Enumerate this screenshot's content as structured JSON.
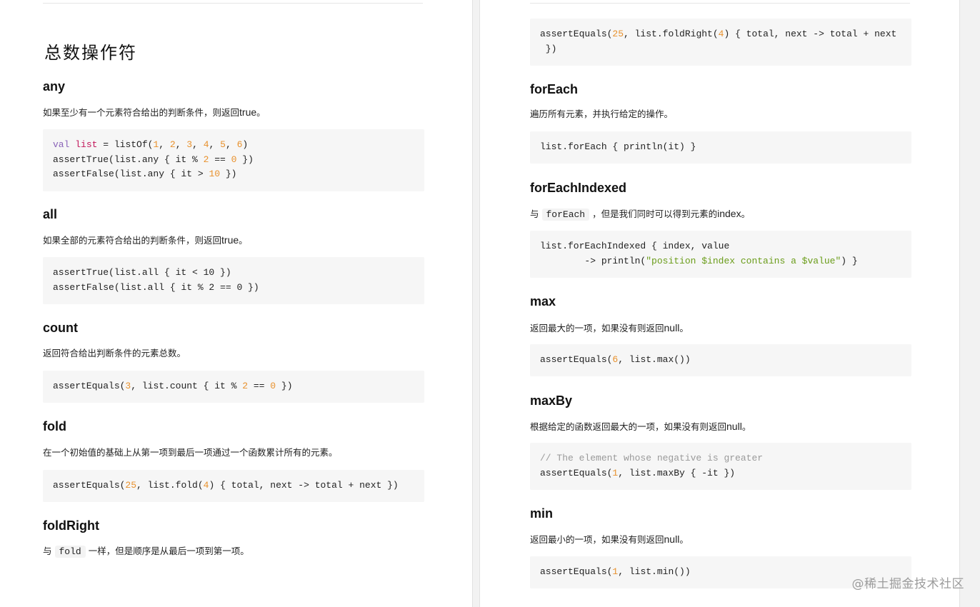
{
  "left": {
    "title": "总数操作符",
    "any": {
      "heading": "any",
      "desc_text": "如果至少有一个元素符合给出的判断条件，则返回",
      "desc_latin": "true",
      "desc_end": "。",
      "code": [
        [
          [
            "kw",
            "val"
          ],
          [
            "t",
            " "
          ],
          [
            "var",
            "list"
          ],
          [
            "t",
            " = listOf("
          ],
          [
            "num",
            "1"
          ],
          [
            "t",
            ", "
          ],
          [
            "num",
            "2"
          ],
          [
            "t",
            ", "
          ],
          [
            "num",
            "3"
          ],
          [
            "t",
            ", "
          ],
          [
            "num",
            "4"
          ],
          [
            "t",
            ", "
          ],
          [
            "num",
            "5"
          ],
          [
            "t",
            ", "
          ],
          [
            "num",
            "6"
          ],
          [
            "t",
            ")"
          ]
        ],
        [
          [
            "t",
            "assertTrue(list.any { it % "
          ],
          [
            "num",
            "2"
          ],
          [
            "t",
            " == "
          ],
          [
            "num",
            "0"
          ],
          [
            "t",
            " })"
          ]
        ],
        [
          [
            "t",
            "assertFalse(list.any { it > "
          ],
          [
            "num",
            "10"
          ],
          [
            "t",
            " })"
          ]
        ]
      ]
    },
    "all": {
      "heading": "all",
      "desc_text": "如果全部的元素符合给出的判断条件，则返回",
      "desc_latin": "true",
      "desc_end": "。",
      "code": [
        [
          [
            "t",
            "assertTrue(list.all { it < 10 })"
          ]
        ],
        [
          [
            "t",
            "assertFalse(list.all { it % 2 == 0 })"
          ]
        ]
      ]
    },
    "count": {
      "heading": "count",
      "desc_text": "返回符合给出判断条件的元素总数。",
      "code": [
        [
          [
            "t",
            "assertEquals("
          ],
          [
            "num",
            "3"
          ],
          [
            "t",
            ", list.count { it % "
          ],
          [
            "num",
            "2"
          ],
          [
            "t",
            " == "
          ],
          [
            "num",
            "0"
          ],
          [
            "t",
            " })"
          ]
        ]
      ]
    },
    "fold": {
      "heading": "fold",
      "desc_text": "在一个初始值的基础上从第一项到最后一项通过一个函数累计所有的元素。",
      "code": [
        [
          [
            "t",
            "assertEquals("
          ],
          [
            "num",
            "25"
          ],
          [
            "t",
            ", list.fold("
          ],
          [
            "num",
            "4"
          ],
          [
            "t",
            ") { total, next -> total + next })"
          ]
        ]
      ]
    },
    "foldRight": {
      "heading": "foldRight",
      "desc_pre": "与",
      "desc_code": "fold",
      "desc_post": "一样，但是顺序是从最后一项到第一项。"
    }
  },
  "right": {
    "foldRight_code": [
      [
        [
          "t",
          "assertEquals("
        ],
        [
          "num",
          "25"
        ],
        [
          "t",
          ", list.foldRight("
        ],
        [
          "num",
          "4"
        ],
        [
          "t",
          ") { total, next -> total + next"
        ]
      ],
      [
        [
          "t",
          " })"
        ]
      ]
    ],
    "forEach": {
      "heading": "forEach",
      "desc_text": "遍历所有元素，并执行给定的操作。",
      "code": [
        [
          [
            "t",
            "list.forEach { println(it) }"
          ]
        ]
      ]
    },
    "forEachIndexed": {
      "heading": "forEachIndexed",
      "desc_pre": "与",
      "desc_code": "forEach",
      "desc_mid": "，但是我们同时可以得到元素的",
      "desc_latin": "index",
      "desc_end": "。",
      "code": [
        [
          [
            "t",
            "list.forEachIndexed { index, value"
          ]
        ],
        [
          [
            "t",
            "        -> println("
          ],
          [
            "str",
            "\"position $index contains a $value\""
          ],
          [
            "t",
            ") }"
          ]
        ]
      ]
    },
    "max": {
      "heading": "max",
      "desc_text": "返回最大的一项，如果没有则返回",
      "desc_latin": "null",
      "desc_end": "。",
      "code": [
        [
          [
            "t",
            "assertEquals("
          ],
          [
            "num",
            "6"
          ],
          [
            "t",
            ", list.max())"
          ]
        ]
      ]
    },
    "maxBy": {
      "heading": "maxBy",
      "desc_text": "根据给定的函数返回最大的一项，如果没有则返回",
      "desc_latin": "null",
      "desc_end": "。",
      "code": [
        [
          [
            "cm",
            "// The element whose negative is greater"
          ]
        ],
        [
          [
            "t",
            "assertEquals("
          ],
          [
            "num",
            "1"
          ],
          [
            "t",
            ", list.maxBy { -it })"
          ]
        ]
      ]
    },
    "min": {
      "heading": "min",
      "desc_text": "返回最小的一项，如果没有则返回",
      "desc_latin": "null",
      "desc_end": "。",
      "code": [
        [
          [
            "t",
            "assertEquals("
          ],
          [
            "num",
            "1"
          ],
          [
            "t",
            ", list.min())"
          ]
        ]
      ]
    }
  },
  "watermark": "@稀土掘金技术社区",
  "colors": {
    "keyword": "#8a63b8",
    "variable": "#c2185b",
    "number": "#e8912d",
    "string": "#6a9c19",
    "comment": "#9a9a9a",
    "code_bg": "#f6f6f6"
  }
}
